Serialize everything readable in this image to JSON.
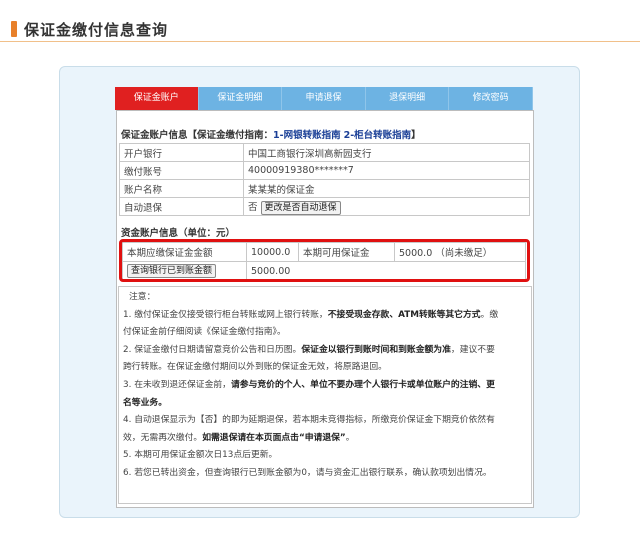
{
  "header": {
    "title": "保证金缴付信息查询"
  },
  "tabs": [
    {
      "label": "保证金账户",
      "active": true
    },
    {
      "label": "保证金明细",
      "active": false
    },
    {
      "label": "申请退保",
      "active": false
    },
    {
      "label": "退保明细",
      "active": false
    },
    {
      "label": "修改密码",
      "active": false
    }
  ],
  "account": {
    "guide_prefix": "保证金账户信息【保证金缴付指南：",
    "guide_link1": "1-网银转账指南",
    "guide_link2": "2-柜台转账指南",
    "guide_suffix": "】",
    "rows": [
      {
        "label": "开户银行",
        "value": "中国工商银行深圳高新园支行"
      },
      {
        "label": "缴付账号",
        "value": "40000919380*******7"
      },
      {
        "label": "账户名称",
        "value": "某某某的保证金"
      }
    ],
    "auto_refund_label": "自动退保",
    "auto_refund_value": "否",
    "auto_refund_button": "更改是否自动退保"
  },
  "fund": {
    "title": "资金账户信息（单位：元）",
    "due_label": "本期应缴保证金金额",
    "due_value": "10000.0",
    "available_label": "本期可用保证金",
    "available_value": "5000.0",
    "available_note": "（尚未缴足）",
    "query_button": "查询银行已到账金额",
    "arrived_value": "5000.00"
  },
  "notes": {
    "title": "注意：",
    "n1a": "1. 缴付保证金仅接受银行柜台转账或网上银行转账，",
    "n1b": "不接受现金存款、ATM转账等其它方式",
    "n1c": "。缴",
    "n1d": "付保证金前仔细阅读《保证金缴付指南》。",
    "n2a": "2. 保证金缴付日期请留意竞价公告和日历图。",
    "n2b": "保证金以银行到账时间和到账金额为准",
    "n2c": "，建议不要",
    "n2d": "跨行转账。在保证金缴付期间以外到账的保证金无效，将原路退回。",
    "n3a": "3. 在未收到退还保证金前，",
    "n3b": "请参与竞价的个人、单位不要办理个人银行卡或单位账户的注销、更",
    "n3c": "名等业务。",
    "n4a": "4. 自动退保显示为【否】的即为延期退保，若本期未竞得指标，所缴竞价保证金下期竞价依然有",
    "n4b": "效，无需再次缴付。",
    "n4c": "如需退保请在本页面点击“申请退保”",
    "n4d": "。",
    "n5": "5. 本期可用保证金额次日13点后更新。",
    "n6": "6. 若您已转出资金，但查询银行已到账金额为0，请与资金汇出银行联系，确认款项划出情况。"
  },
  "colors": {
    "accent_red": "#e02020",
    "tab_blue": "#6db3e3",
    "highlight_red": "#e01010",
    "link_blue": "#1a3f96"
  }
}
